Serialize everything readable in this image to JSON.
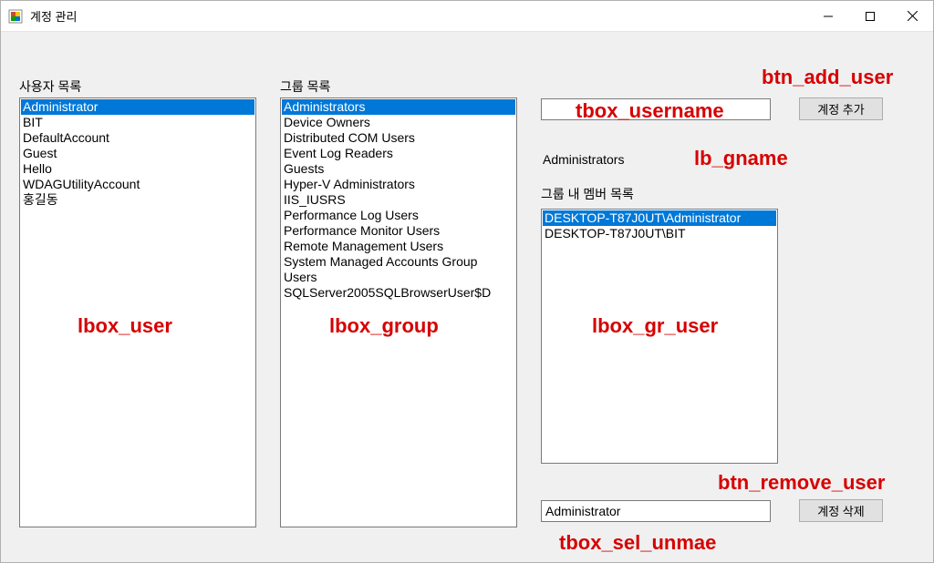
{
  "window": {
    "title": "계정 관리"
  },
  "labels": {
    "user_list": "사용자 목록",
    "group_list": "그룹 목록",
    "group_members": "그룹 내 멤버 목록",
    "selected_group": "Administrators"
  },
  "user_list": {
    "items": [
      "Administrator",
      "BIT",
      "DefaultAccount",
      "Guest",
      "Hello",
      "WDAGUtilityAccount",
      "홍길동"
    ],
    "selected_index": 0
  },
  "group_list": {
    "items": [
      "Administrators",
      "Device Owners",
      "Distributed COM Users",
      "Event Log Readers",
      "Guests",
      "Hyper-V Administrators",
      "IIS_IUSRS",
      "Performance Log Users",
      "Performance Monitor Users",
      "Remote Management Users",
      "System Managed Accounts Group",
      "Users",
      "SQLServer2005SQLBrowserUser$D"
    ],
    "selected_index": 0
  },
  "group_member_list": {
    "items": [
      "DESKTOP-T87J0UT\\Administrator",
      "DESKTOP-T87J0UT\\BIT"
    ],
    "selected_index": 0
  },
  "inputs": {
    "tbox_username_value": "",
    "tbox_username_placeholder": "",
    "tbox_sel_uname_value": "Administrator"
  },
  "buttons": {
    "add_user": "계정 추가",
    "remove_user": "계정 삭제"
  },
  "annotations": {
    "btn_add_user": "btn_add_user",
    "tbox_username": "tbox_username",
    "lb_gname": "lb_gname",
    "lbox_user": "lbox_user",
    "lbox_group": "lbox_group",
    "lbox_gr_user": "lbox_gr_user",
    "btn_remove_user": "btn_remove_user",
    "tbox_sel_uname": "tbox_sel_unmae"
  }
}
